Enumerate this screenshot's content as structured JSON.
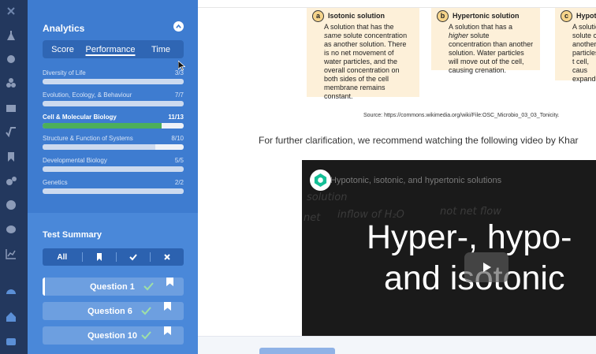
{
  "analytics": {
    "title": "Analytics",
    "tabs": [
      "Score",
      "Performance",
      "Time"
    ],
    "selected_tab": "Performance",
    "categories": [
      {
        "name": "Diversity of Life",
        "score": "3/3",
        "progress": 1.0,
        "highlight": false
      },
      {
        "name": "Evolution, Ecology, & Behaviour",
        "score": "7/7",
        "progress": 1.0,
        "highlight": false
      },
      {
        "name": "Cell & Molecular Biology",
        "score": "11/13",
        "progress": 0.846,
        "highlight": true
      },
      {
        "name": "Structure & Function of Systems",
        "score": "8/10",
        "progress": 0.8,
        "highlight": false
      },
      {
        "name": "Developmental Biology",
        "score": "5/5",
        "progress": 1.0,
        "highlight": false
      },
      {
        "name": "Genetics",
        "score": "2/2",
        "progress": 1.0,
        "highlight": false
      }
    ]
  },
  "test_summary": {
    "title": "Test Summary",
    "filters": {
      "all": "All",
      "icons": [
        "bookmark-icon",
        "check-icon",
        "close-icon"
      ]
    },
    "questions": [
      {
        "label": "Question 1",
        "correct": true,
        "current": true
      },
      {
        "label": "Question 6",
        "correct": true,
        "current": false
      },
      {
        "label": "Question 10",
        "correct": true,
        "current": false
      }
    ]
  },
  "content": {
    "boxes": [
      {
        "letter": "a",
        "title": "Isotonic solution",
        "pre": "A solution that has the ",
        "em": "same",
        "post": " solute concentration as another solution. There is no net movement of water particles, and the overall concentration on both sides of the cell membrane remains constant."
      },
      {
        "letter": "b",
        "title": "Hypertonic solution",
        "pre": "A solution that has a ",
        "em": "higher",
        "post": " solute concentration than another solution. Water particles will move out of the cell, causing crenation."
      },
      {
        "letter": "c",
        "title": "Hypoton",
        "pre": "A solutio",
        "em": "",
        "post": " solute c another s particles t cell, caus expand a"
      }
    ],
    "source": "Source: https://commons.wikimedia.org/wiki/File:OSC_Microbio_03_03_Tonicity.",
    "paragraph": "For further clarification, we recommend watching the following video by Khar",
    "video": {
      "tiny_title": "Hypotonic, isotonic, and hypertonic solutions",
      "line1": "Hyper-, hypo-",
      "line2": "and isotonic"
    }
  },
  "colors": {
    "rail": "#23385e",
    "sidebar": "#4a88d9",
    "analytics_bg": "#3e7cd0",
    "highlight_bar": "#4caf5a",
    "box_bg": "#fdf0d9"
  }
}
